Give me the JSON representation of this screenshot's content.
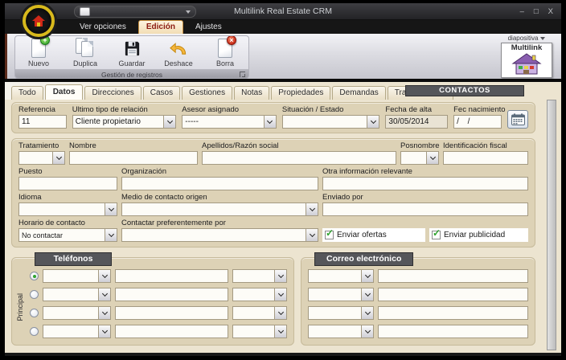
{
  "window": {
    "title": "Multilink Real Estate CRM",
    "minimize": "–",
    "maximize": "□",
    "close": "X"
  },
  "menu": {
    "items": [
      {
        "label": "Ver opciones"
      },
      {
        "label": "Edición"
      },
      {
        "label": "Ajustes"
      }
    ]
  },
  "ribbon": {
    "buttons": [
      {
        "label": "Nuevo"
      },
      {
        "label": "Duplica"
      },
      {
        "label": "Guardar"
      },
      {
        "label": "Deshace"
      },
      {
        "label": "Borra"
      }
    ],
    "group_label": "Gestión de registros",
    "slide_label": "diapositiva",
    "logo_label": "Multilink"
  },
  "tabs": {
    "items": [
      {
        "label": "Todo"
      },
      {
        "label": "Datos"
      },
      {
        "label": "Direcciones"
      },
      {
        "label": "Casos"
      },
      {
        "label": "Gestiones"
      },
      {
        "label": "Notas"
      },
      {
        "label": "Propiedades"
      },
      {
        "label": "Demandas"
      },
      {
        "label": "Transacciones"
      }
    ],
    "active": "Datos",
    "badge": "CONTACTOS"
  },
  "form": {
    "referencia_label": "Referencia",
    "referencia_value": "11",
    "tipo_relacion_label": "Ultimo tipo de relación",
    "tipo_relacion_value": "Cliente propietario",
    "asesor_label": "Asesor asignado",
    "asesor_value": "-----",
    "situacion_label": "Situación / Estado",
    "situacion_value": "",
    "fecha_alta_label": "Fecha de alta",
    "fecha_alta_value": "30/05/2014",
    "fec_nacimiento_label": "Fec nacimiento",
    "fec_nacimiento_value": "/ /",
    "tratamiento_label": "Tratamiento",
    "nombre_label": "Nombre",
    "apellidos_label": "Apellidos/Razón social",
    "posnombre_label": "Posnombre",
    "id_fiscal_label": "Identificación fiscal",
    "puesto_label": "Puesto",
    "organizacion_label": "Organización",
    "otra_info_label": "Otra información relevante",
    "idioma_label": "Idioma",
    "medio_contacto_label": "Medio de contacto origen",
    "enviado_por_label": "Enviado por",
    "horario_label": "Horario de contacto",
    "horario_value": "No contactar",
    "contactar_label": "Contactar preferentemente por",
    "enviar_ofertas_label": "Enviar ofertas",
    "enviar_ofertas_checked": true,
    "enviar_publicidad_label": "Enviar publicidad",
    "enviar_publicidad_checked": true
  },
  "telefonos": {
    "title": "Teléfonos",
    "side_label": "Principal",
    "rows": 4,
    "principal_selected_row": 1
  },
  "correo": {
    "title": "Correo electrónico",
    "rows": 4
  },
  "colors": {
    "content_bg": "#ece4d0",
    "panel_bg": "#ddd2b6",
    "header_bar": "#55565a",
    "check_green": "#2fa32f",
    "logo_ring": "#d8b91c",
    "active_menu_text": "#8b1a12"
  }
}
